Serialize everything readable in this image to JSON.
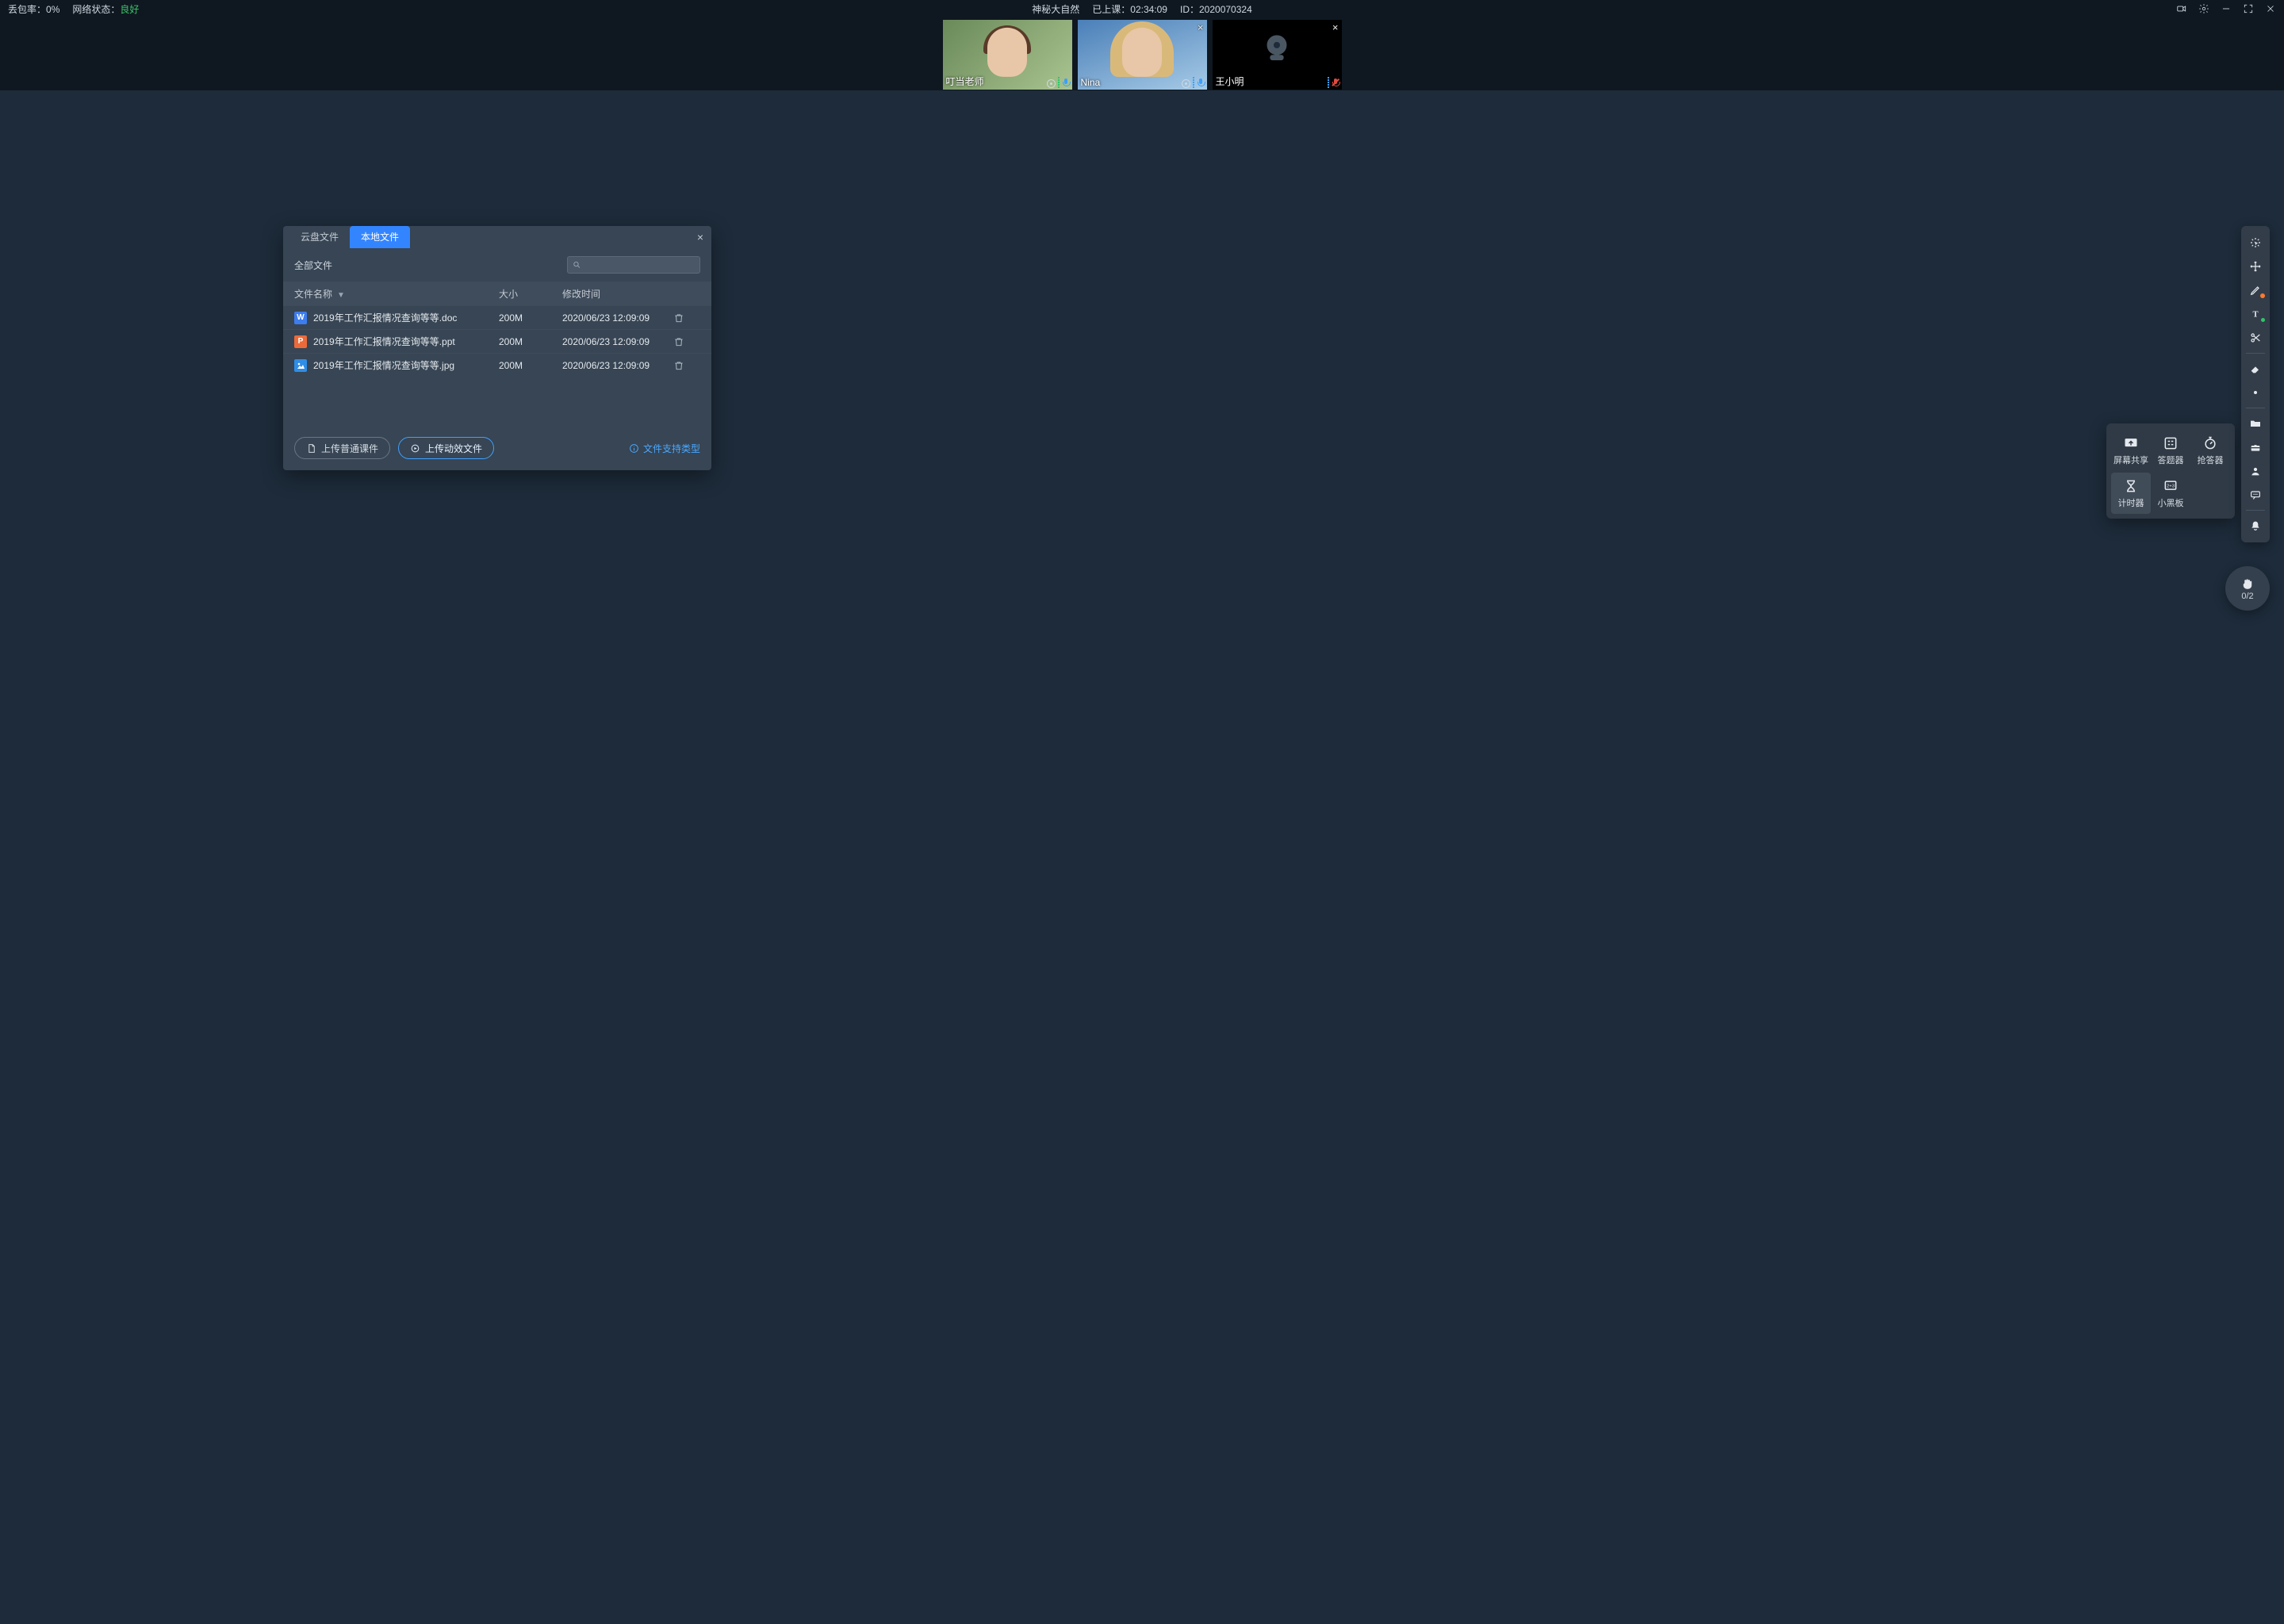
{
  "topbar": {
    "packet_loss_label": "丢包率：",
    "packet_loss_value": "0%",
    "net_label": "网络状态：",
    "net_value": "良好",
    "title": "神秘大自然",
    "elapsed_label": "已上课：",
    "elapsed_value": "02:34:09",
    "id_label": "ID：",
    "id_value": "2020070324"
  },
  "videos": [
    {
      "name": "叮当老师",
      "muted": false,
      "camera_off": false
    },
    {
      "name": "Nina",
      "muted": false,
      "camera_off": false
    },
    {
      "name": "王小明",
      "muted": true,
      "camera_off": true
    }
  ],
  "dialog": {
    "tab_cloud": "云盘文件",
    "tab_local": "本地文件",
    "all_files": "全部文件",
    "columns": {
      "name": "文件名称",
      "size": "大小",
      "mtime": "修改时间"
    },
    "rows": [
      {
        "type": "w",
        "name": "2019年工作汇报情况查询等等.doc",
        "size": "200M",
        "mtime": "2020/06/23 12:09:09"
      },
      {
        "type": "p",
        "name": "2019年工作汇报情况查询等等.ppt",
        "size": "200M",
        "mtime": "2020/06/23 12:09:09"
      },
      {
        "type": "i",
        "name": "2019年工作汇报情况查询等等.jpg",
        "size": "200M",
        "mtime": "2020/06/23 12:09:09"
      }
    ],
    "upload_normal": "上传普通课件",
    "upload_anim": "上传动效文件",
    "supported": "文件支持类型"
  },
  "tools_pop": {
    "screen_share": "屏幕共享",
    "answer": "答题器",
    "buzzer": "抢答器",
    "timer": "计时器",
    "blackboard": "小黑板"
  },
  "hand": {
    "count": "0/2"
  },
  "icons": {
    "fic_w": "W",
    "fic_p": "P",
    "fic_i": "▲"
  }
}
